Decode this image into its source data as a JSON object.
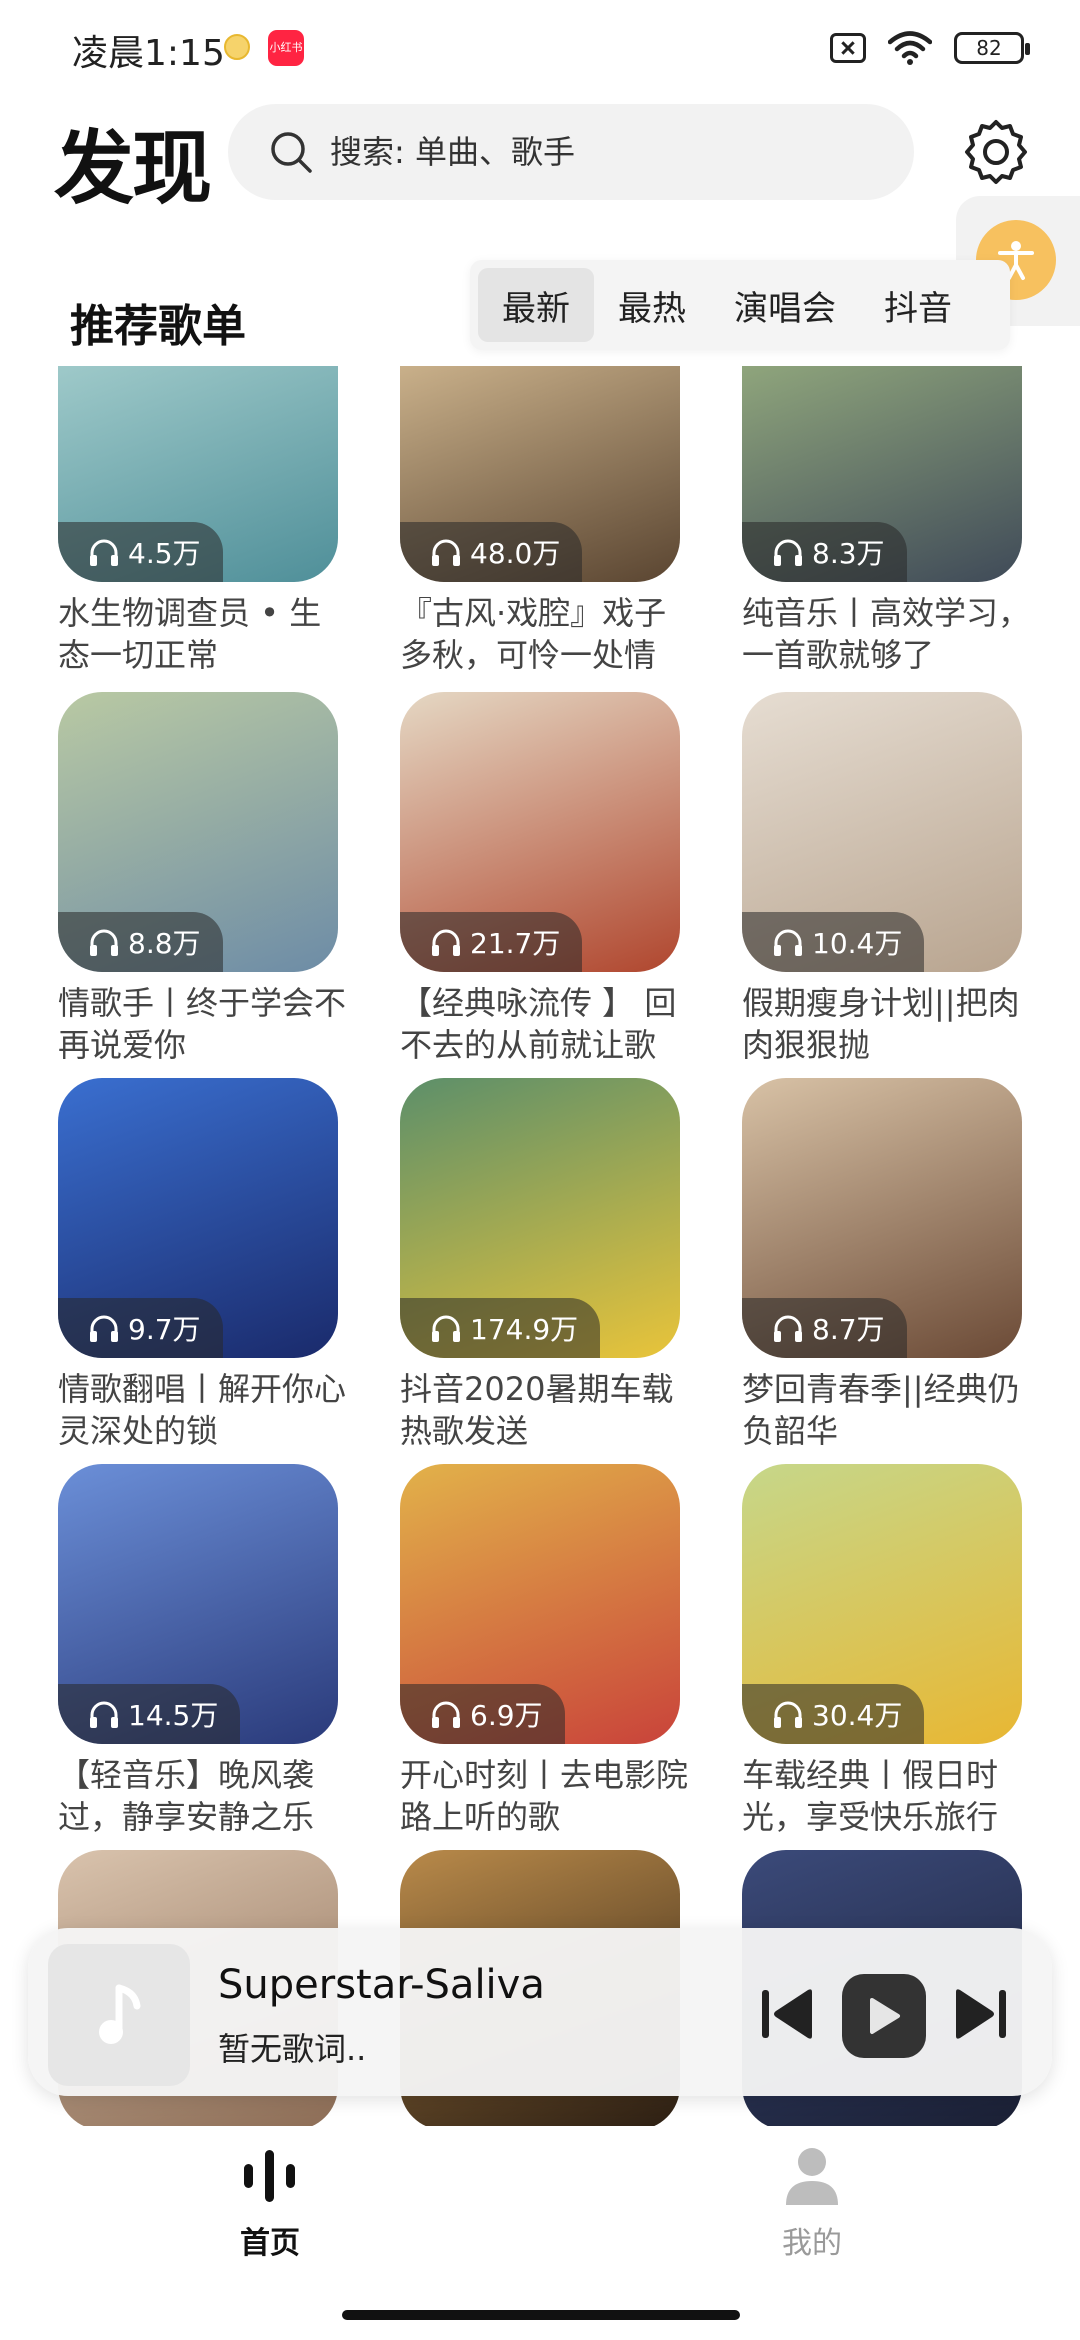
{
  "status_bar": {
    "time": "凌晨1:15",
    "app_badge": "小红书",
    "battery": "82"
  },
  "header": {
    "title": "发现",
    "search_placeholder": "搜索: 单曲、歌手"
  },
  "section": {
    "title": "推荐歌单",
    "tabs": [
      {
        "label": "最新",
        "active": true
      },
      {
        "label": "最热",
        "active": false
      },
      {
        "label": "演唱会",
        "active": false
      },
      {
        "label": "抖音",
        "active": false
      }
    ]
  },
  "playlists": [
    {
      "count": "4.5万",
      "title": "水生物调查员 • 生态一切正常",
      "colors": [
        "#9ec9c9",
        "#4f8f99"
      ]
    },
    {
      "count": "48.0万",
      "title": "『古风·戏腔』戏子多秋，可怜一处情",
      "colors": [
        "#c9b08a",
        "#5a4531"
      ]
    },
    {
      "count": "8.3万",
      "title": "纯音乐丨高效学习，一首歌就够了",
      "colors": [
        "#8fa57c",
        "#3f4a58"
      ]
    },
    {
      "count": "8.8万",
      "title": "情歌手丨终于学会不再说爱你",
      "colors": [
        "#b9c9a3",
        "#6d8ca6"
      ]
    },
    {
      "count": "21.7万",
      "title": "【经典咏流传 】 回不去的从前就让歌",
      "colors": [
        "#e5d8c4",
        "#b0462e"
      ]
    },
    {
      "count": "10.4万",
      "title": "假期瘦身计划||把肉肉狠狠抛",
      "colors": [
        "#e6ddd2",
        "#b8a48f"
      ]
    },
    {
      "count": "9.7万",
      "title": "情歌翻唱丨解开你心灵深处的锁",
      "colors": [
        "#3a6fd0",
        "#1a2a6b"
      ]
    },
    {
      "count": "174.9万",
      "title": "抖音2020暑期车载热歌发送",
      "colors": [
        "#5c8f6a",
        "#e9c43a"
      ]
    },
    {
      "count": "8.7万",
      "title": "梦回青春季||经典仍负韶华",
      "colors": [
        "#d8c2a6",
        "#6b4a36"
      ]
    },
    {
      "count": "14.5万",
      "title": "【轻音乐】晚风袭过，静享安静之乐",
      "colors": [
        "#6b8fd8",
        "#2a3a7a"
      ]
    },
    {
      "count": "6.9万",
      "title": "开心时刻丨去电影院路上听的歌",
      "colors": [
        "#e2b24a",
        "#c9433a"
      ]
    },
    {
      "count": "30.4万",
      "title": "车载经典丨假日时光，享受快乐旅行",
      "colors": [
        "#c6d78a",
        "#e8b733"
      ]
    },
    {
      "count": "",
      "title": "",
      "colors": [
        "#d9c3ad",
        "#8c6c55"
      ]
    },
    {
      "count": "",
      "title": "",
      "colors": [
        "#b98a4a",
        "#2a1d12"
      ]
    },
    {
      "count": "",
      "title": "",
      "colors": [
        "#3b4a7a",
        "#1a1f33"
      ]
    }
  ],
  "player": {
    "song": "Superstar-Saliva",
    "lyric": "暂无歌词.."
  },
  "bottom_nav": {
    "home": "首页",
    "mine": "我的"
  }
}
